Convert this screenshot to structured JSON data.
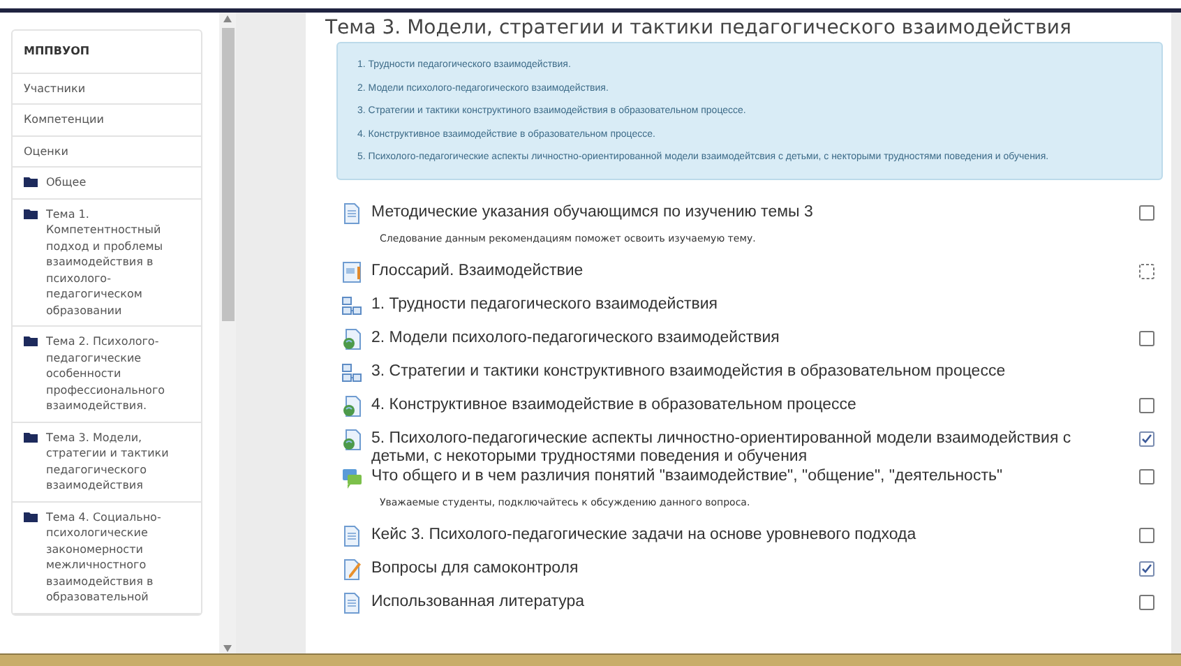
{
  "sidebar": {
    "title": "МППВУОП",
    "links": [
      "Участники",
      "Компетенции",
      "Оценки"
    ],
    "sections": [
      {
        "label": "Общее"
      },
      {
        "label": "Тема 1. Компетентностный подход и проблемы взаимодействия в психолого-педагогическом образовании"
      },
      {
        "label": "Тема 2. Психолого-педагогические особенности профессионального взаимодействия."
      },
      {
        "label": "Тема 3. Модели, стратегии и тактики педагогического взаимодействия"
      },
      {
        "label": "Тема 4. Социально-психологические закономерности межличностного взаимодействия в образовательной"
      }
    ]
  },
  "section": {
    "title": "Тема 3. Модели, стратегии и тактики педагогического взаимодействия",
    "summary": [
      "1. Трудности педагогического взаимодействия.",
      "2. Модели психолого-педагогического взаимодействия.",
      "3. Стратегии и тактики конструктиного взаимодействия  в образовательном процессе.",
      "4. Конструктивное взаимодействие в образовательном процессе.",
      "5. Психолого-педагогические аспекты  личностно-ориентированной модели взаимодейтсвия с детьми, с некторыми трудностями  поведения и обучения."
    ]
  },
  "activities": [
    {
      "kind": "page",
      "title": "Методические указания обучающимся по изучению темы 3",
      "description": "Следование данным рекомендациям поможет освоить изучаемую тему.",
      "auto": false,
      "checked": false
    },
    {
      "kind": "glossary",
      "title": "Глоссарий. Взаимодействие",
      "auto": true,
      "checked": false
    },
    {
      "kind": "book",
      "title": "1. Трудности педагогического взаимодействия"
    },
    {
      "kind": "url",
      "title": "2. Модели психолого-педагогического взаимодействия",
      "auto": false,
      "checked": false
    },
    {
      "kind": "book",
      "title": "3. Стратегии и тактики конструктивного взаимодейстия в образовательном процессе"
    },
    {
      "kind": "url",
      "title": "4. Конструктивное взаимодействие в образовательном процессе",
      "auto": false,
      "checked": false
    },
    {
      "kind": "url",
      "title": "5. Психолого-педагогические аспекты личностно-ориентированной модели взаимодействия с детьми, с некоторыми трудностями поведения и обучения",
      "auto": false,
      "checked": true
    },
    {
      "kind": "forum",
      "title": "Что общего и в чем различия понятий \"взаимодействие\", \"общение\", \"деятельность\"",
      "description": "Уважаемые студенты, подключайтесь к обсуждению данного вопроса.",
      "auto": false,
      "checked": false
    },
    {
      "kind": "page",
      "title": "Кейс 3. Психолого-педагогические задачи на основе уровневого подхода",
      "auto": false,
      "checked": false
    },
    {
      "kind": "assign",
      "title": "Вопросы для самоконтроля",
      "auto": false,
      "checked": true
    },
    {
      "kind": "page",
      "title": "Использованная литература",
      "auto": false,
      "checked": false
    }
  ]
}
